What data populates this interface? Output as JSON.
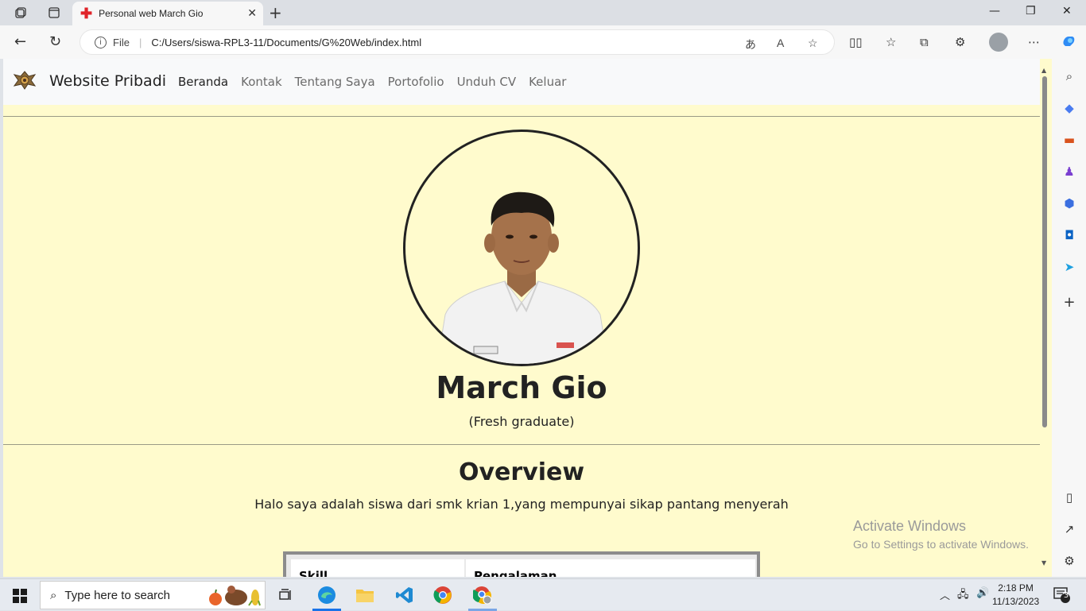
{
  "browser": {
    "tab_title": "Personal web March Gio",
    "url": "C:/Users/siswa-RPL3-11/Documents/G%20Web/index.html",
    "file_label": "File"
  },
  "page": {
    "brand": "Website Pribadi",
    "nav": [
      "Beranda",
      "Kontak",
      "Tentang Saya",
      "Portofolio",
      "Unduh CV",
      "Keluar"
    ],
    "active_nav": "Beranda",
    "name": "March Gio",
    "role": "(Fresh graduate)",
    "overview_title": "Overview",
    "overview_text": "Halo saya adalah siswa dari smk krian 1,yang mempunyai sikap pantang menyerah",
    "table_headers": [
      "Skill",
      "Pengalaman"
    ],
    "colors": {
      "background": "#fffbcd",
      "navbar": "#f8f9fa"
    }
  },
  "watermark": {
    "title": "Activate Windows",
    "subtitle": "Go to Settings to activate Windows."
  },
  "taskbar": {
    "search_placeholder": "Type here to search",
    "time": "2:18 PM",
    "date": "11/13/2023",
    "notification_count": "3"
  }
}
